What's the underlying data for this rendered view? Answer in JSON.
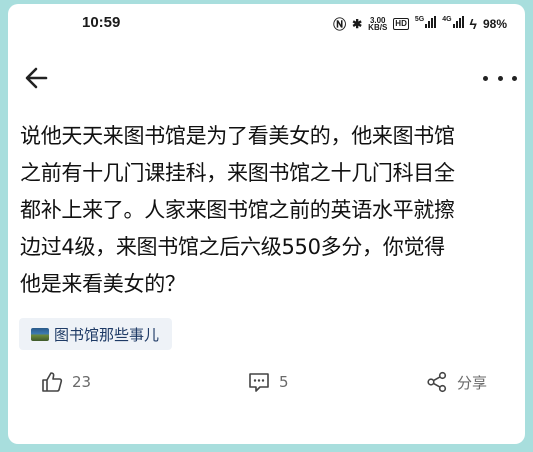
{
  "status_bar": {
    "time": "10:59",
    "speed_top": "3.00",
    "speed_bottom": "KB/S",
    "hd": "HD",
    "sim1_tag": "5G",
    "sim2_tag": "4G",
    "battery": "98%"
  },
  "post": {
    "lines": [
      "说他天天来图书馆是为了看美女的，他来图书馆",
      "之前有十几门课挂科，来图书馆之十几门科目全",
      "都补上来了。人家来图书馆之前的英语水平就擦",
      "边过4级，来图书馆之后六级550多分，你觉得",
      "他是来看美女的？"
    ]
  },
  "tag": {
    "label": "图书馆那些事儿"
  },
  "actions": {
    "like_count": "23",
    "comment_count": "5",
    "share_label": "分享"
  },
  "colors": {
    "background": "#a8dedd",
    "tag_bg": "#eef2f7",
    "tag_text": "#1f3b66",
    "action_gray": "#6a6a6a"
  }
}
